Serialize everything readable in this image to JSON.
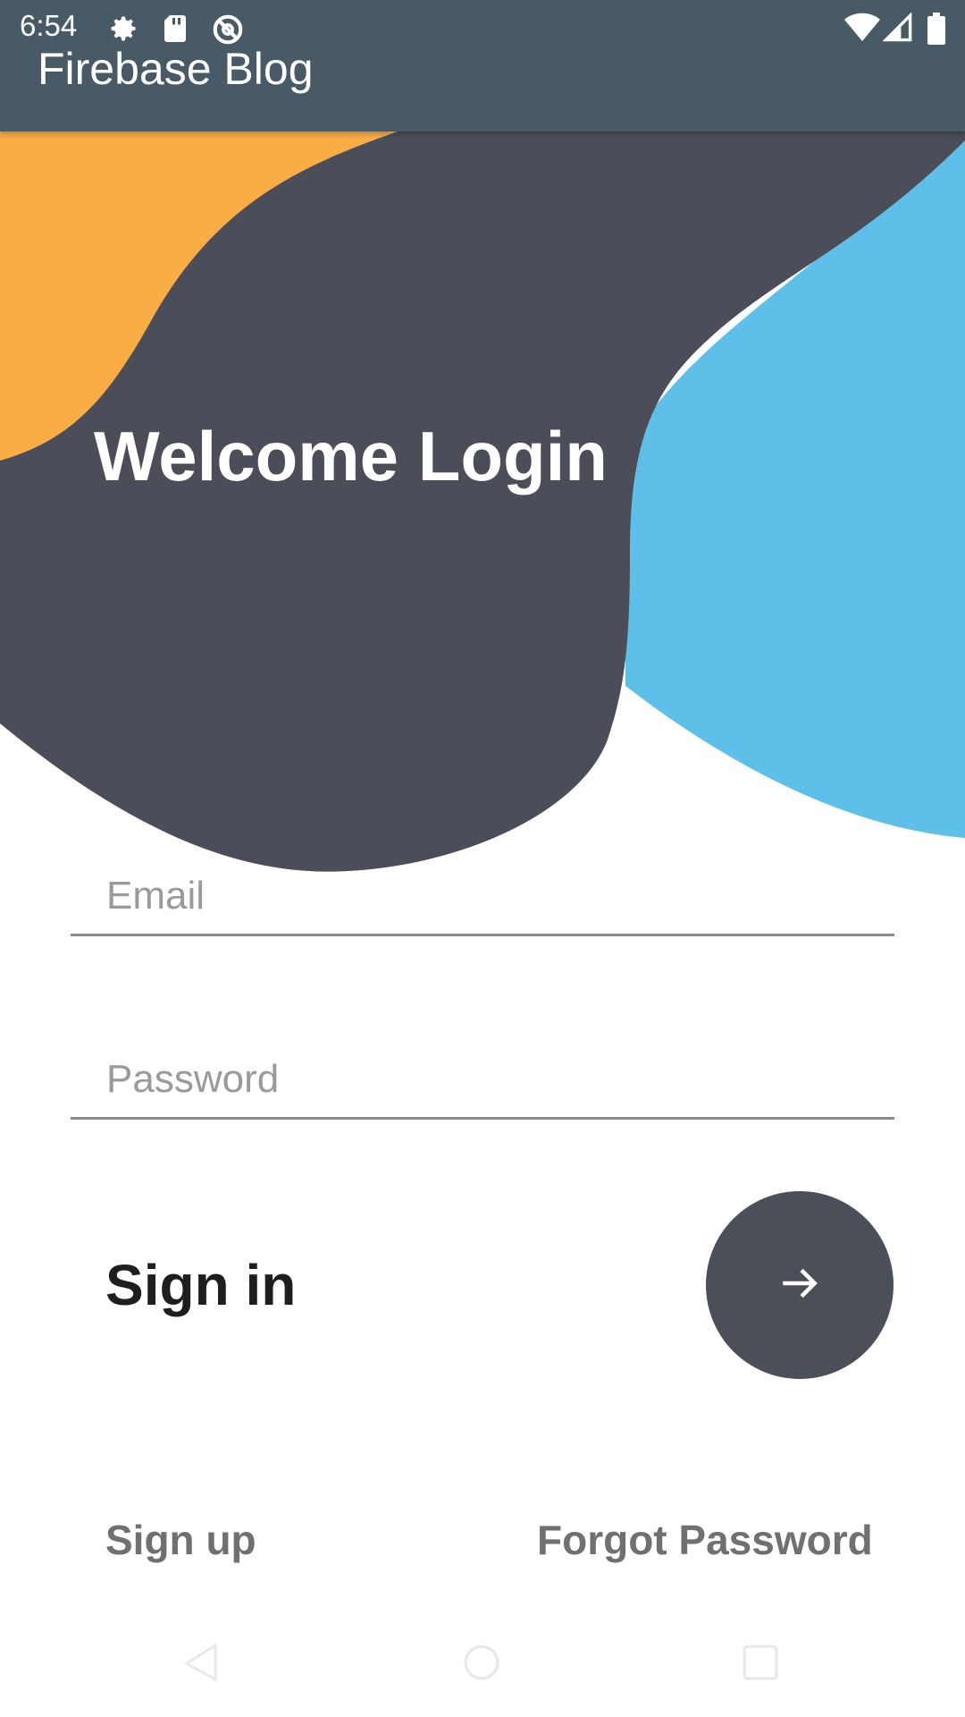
{
  "status_bar": {
    "time": "6:54",
    "left_icons": [
      "gear-icon",
      "sd-card-icon",
      "no-disturb-icon"
    ],
    "right_icons": [
      "wifi-icon",
      "signal-icon",
      "battery-icon"
    ]
  },
  "app_bar": {
    "title": "Firebase Blog",
    "color": "#475a66"
  },
  "hero": {
    "title": "Welcome Login",
    "colors": {
      "orange": "#fbad45",
      "dark": "#4b4e58",
      "blue": "#5ec0e8"
    }
  },
  "form": {
    "email_placeholder": "Email",
    "email_value": "",
    "password_placeholder": "Password",
    "password_value": ""
  },
  "signin": {
    "label": "Sign in",
    "button_icon": "arrow-right-icon",
    "button_color": "#4b4f58"
  },
  "links": {
    "signup": "Sign up",
    "forgot_password": "Forgot Password"
  },
  "nav_bar": {
    "buttons": [
      "back-icon",
      "home-icon",
      "recents-icon"
    ]
  }
}
